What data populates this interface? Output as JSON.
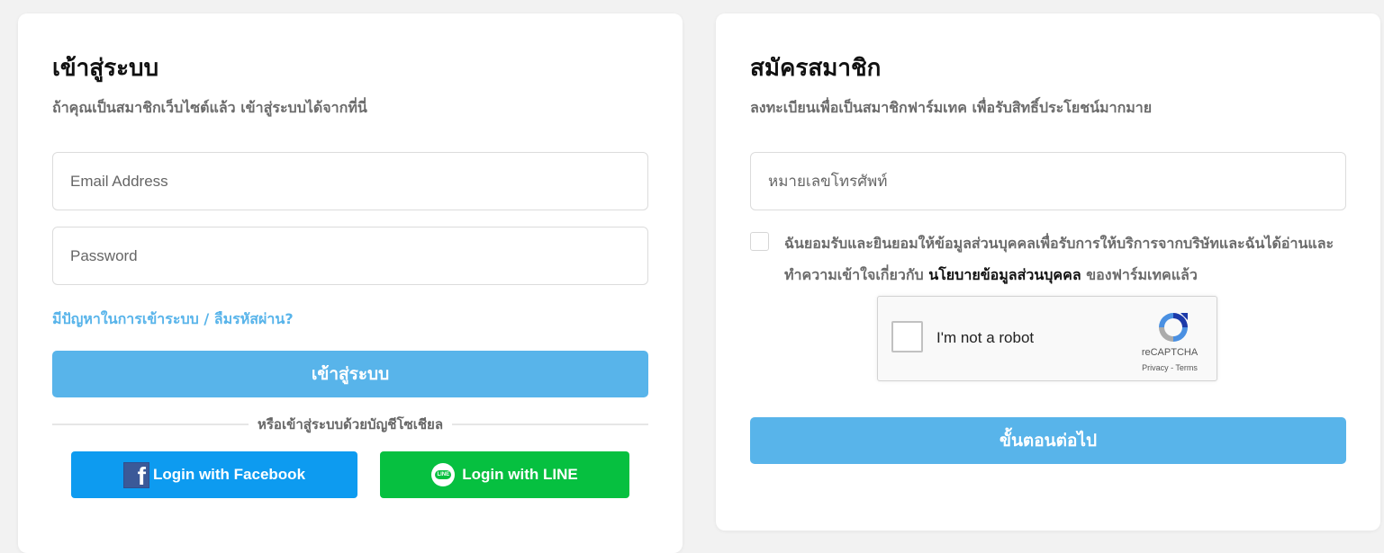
{
  "login": {
    "title": "เข้าสู่ระบบ",
    "subtitle": "ถ้าคุณเป็นสมาชิกเว็บไซต์แล้ว เข้าสู่ระบบได้จากที่นี่",
    "email_placeholder": "Email Address",
    "password_placeholder": "Password",
    "forgot_link": "มีปัญหาในการเข้าระบบ / ลืมรหัสผ่าน?",
    "submit_label": "เข้าสู่ระบบ",
    "divider_text": "หรือเข้าสู่ระบบด้วยบัญชีโซเชียล",
    "facebook_label": "Login with Facebook",
    "line_label": "Login with LINE",
    "facebook_icon_glyph": "f",
    "line_icon_glyph": "LINE"
  },
  "register": {
    "title": "สมัครสมาชิก",
    "subtitle": "ลงทะเบียนเพื่อเป็นสมาชิกฟาร์มเทค เพื่อรับสิทธิ์ประโยชน์มากมาย",
    "phone_placeholder": "หมายเลขโทรศัพท์",
    "consent_text_before": "ฉันยอมรับและยินยอมให้ข้อมูลส่วนบุคคลเพื่อรับการให้บริการจากบริษัทและฉันได้อ่านและทำความเข้าใจเกี่ยวกับ ",
    "consent_policy_link": "นโยบายข้อมูลส่วนบุคคล",
    "consent_text_after": " ของฟาร์มเทคแล้ว",
    "next_label": "ขั้นตอนต่อไป"
  },
  "recaptcha": {
    "label": "I'm not a robot",
    "brand": "reCAPTCHA",
    "terms": "Privacy - Terms"
  },
  "colors": {
    "primary": "#58b4ea",
    "facebook": "#0d9bf0",
    "line": "#06c040"
  },
  "icons": {
    "facebook": "facebook-icon",
    "line": "line-icon",
    "recaptcha": "recaptcha-logo-icon"
  }
}
